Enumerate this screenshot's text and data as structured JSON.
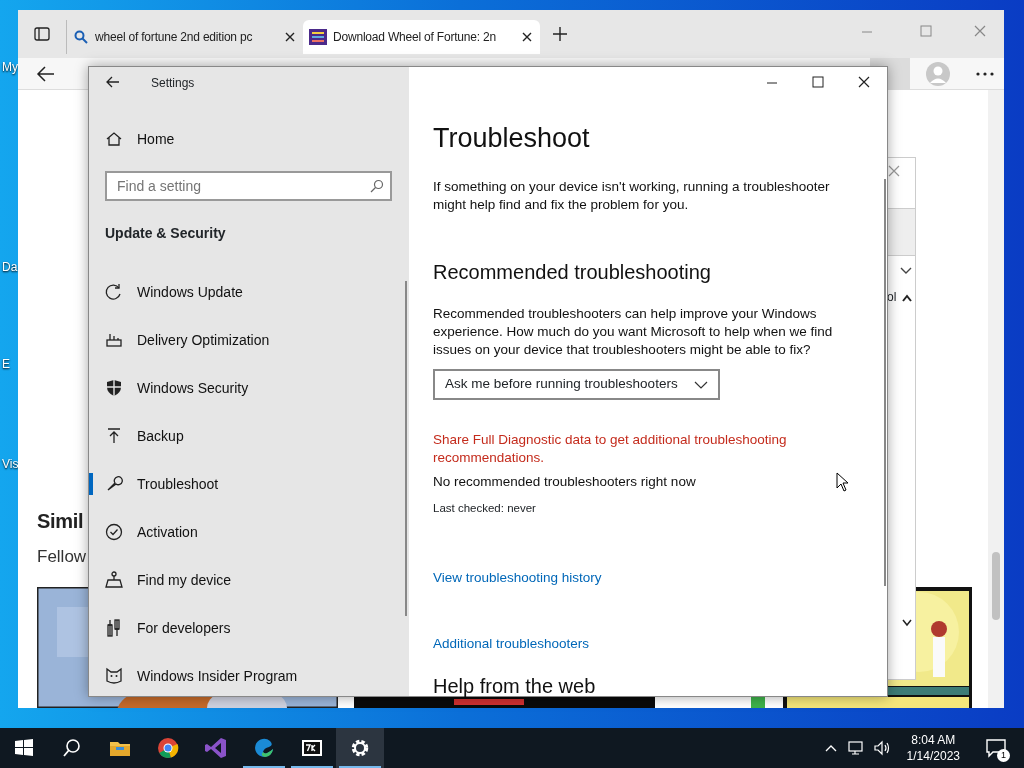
{
  "desktop": {
    "icon_labels": [
      "My",
      "Da",
      "E",
      "Vis"
    ]
  },
  "browser": {
    "tabs": [
      {
        "kind": "search",
        "title": "wheel of fortune 2nd edition pc",
        "selected": false
      },
      {
        "kind": "site",
        "title": "Download Wheel of Fortune: 2n",
        "selected": true
      }
    ],
    "page": {
      "heading": "Simil",
      "subtext": "Fellow"
    },
    "side_panel": {
      "text": "ol"
    }
  },
  "settings": {
    "title": "Settings",
    "home": "Home",
    "search": {
      "placeholder": "Find a setting"
    },
    "section": "Update & Security",
    "nav": [
      {
        "label": "Windows Update",
        "selected": false
      },
      {
        "label": "Delivery Optimization",
        "selected": false
      },
      {
        "label": "Windows Security",
        "selected": false
      },
      {
        "label": "Backup",
        "selected": false
      },
      {
        "label": "Troubleshoot",
        "selected": true
      },
      {
        "label": "Activation",
        "selected": false
      },
      {
        "label": "Find my device",
        "selected": false
      },
      {
        "label": "For developers",
        "selected": false
      },
      {
        "label": "Windows Insider Program",
        "selected": false
      }
    ],
    "content": {
      "title": "Troubleshoot",
      "intro": "If something on your device isn't working, running a troubleshooter might help find and fix the problem for you.",
      "rec_heading": "Recommended troubleshooting",
      "rec_text": "Recommended troubleshooters can help improve your Windows experience. How much do you want Microsoft to help when we find issues on your device that troubleshooters might be able to fix?",
      "dropdown": "Ask me before running troubleshooters",
      "diag_link": "Share Full Diagnostic data to get additional troubleshooting recommendations.",
      "status": "No recommended troubleshooters right now",
      "last_checked": "Last checked: never",
      "links": [
        "View troubleshooting history",
        "Additional troubleshooters"
      ],
      "help_heading": "Help from the web"
    }
  },
  "taskbar": {
    "apps": [
      {
        "running": false,
        "active": false
      },
      {
        "running": false,
        "active": false
      },
      {
        "running": false,
        "active": false
      },
      {
        "running": true,
        "active": false
      },
      {
        "running": true,
        "active": false
      },
      {
        "running": true,
        "active": true
      }
    ],
    "time": "8:04 AM",
    "date": "1/14/2023",
    "notifications": "1"
  }
}
